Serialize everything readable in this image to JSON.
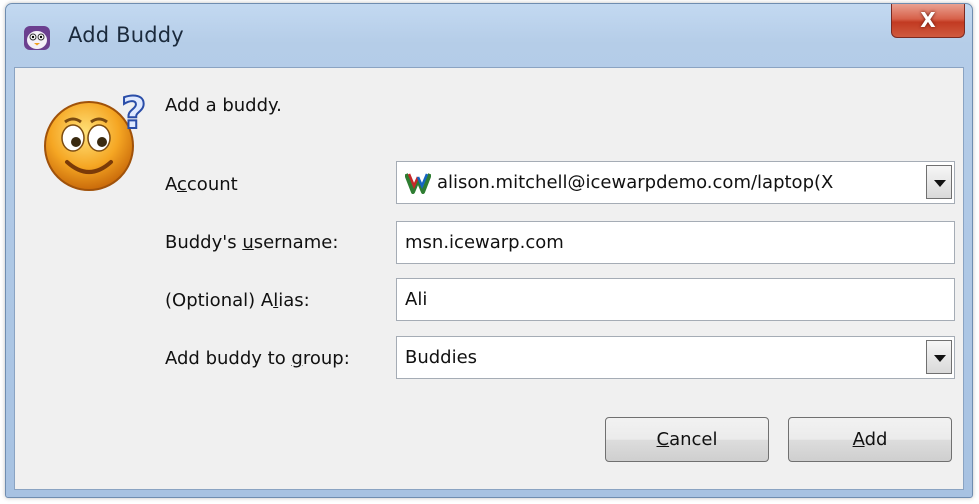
{
  "window": {
    "title": "Add Buddy",
    "close_label": "X"
  },
  "header": {
    "text": "Add a buddy."
  },
  "form": {
    "account": {
      "label_pre": "A",
      "label_u": "c",
      "label_post": "count",
      "value": "alison.mitchell@icewarpdemo.com/laptop(X",
      "icon": "protocol-icon"
    },
    "username": {
      "label_pre": "Buddy's ",
      "label_u": "u",
      "label_post": "sername:",
      "value": "msn.icewarp.com"
    },
    "alias": {
      "label_pre": "(Optional) A",
      "label_u": "l",
      "label_post": "ias:",
      "value": "Ali"
    },
    "group": {
      "label_pre": "Add buddy to ",
      "label_u": "g",
      "label_post": "roup:",
      "value": "Buddies"
    }
  },
  "buttons": {
    "cancel": {
      "u": "C",
      "rest": "ancel"
    },
    "add": {
      "u": "A",
      "rest": "dd"
    }
  }
}
